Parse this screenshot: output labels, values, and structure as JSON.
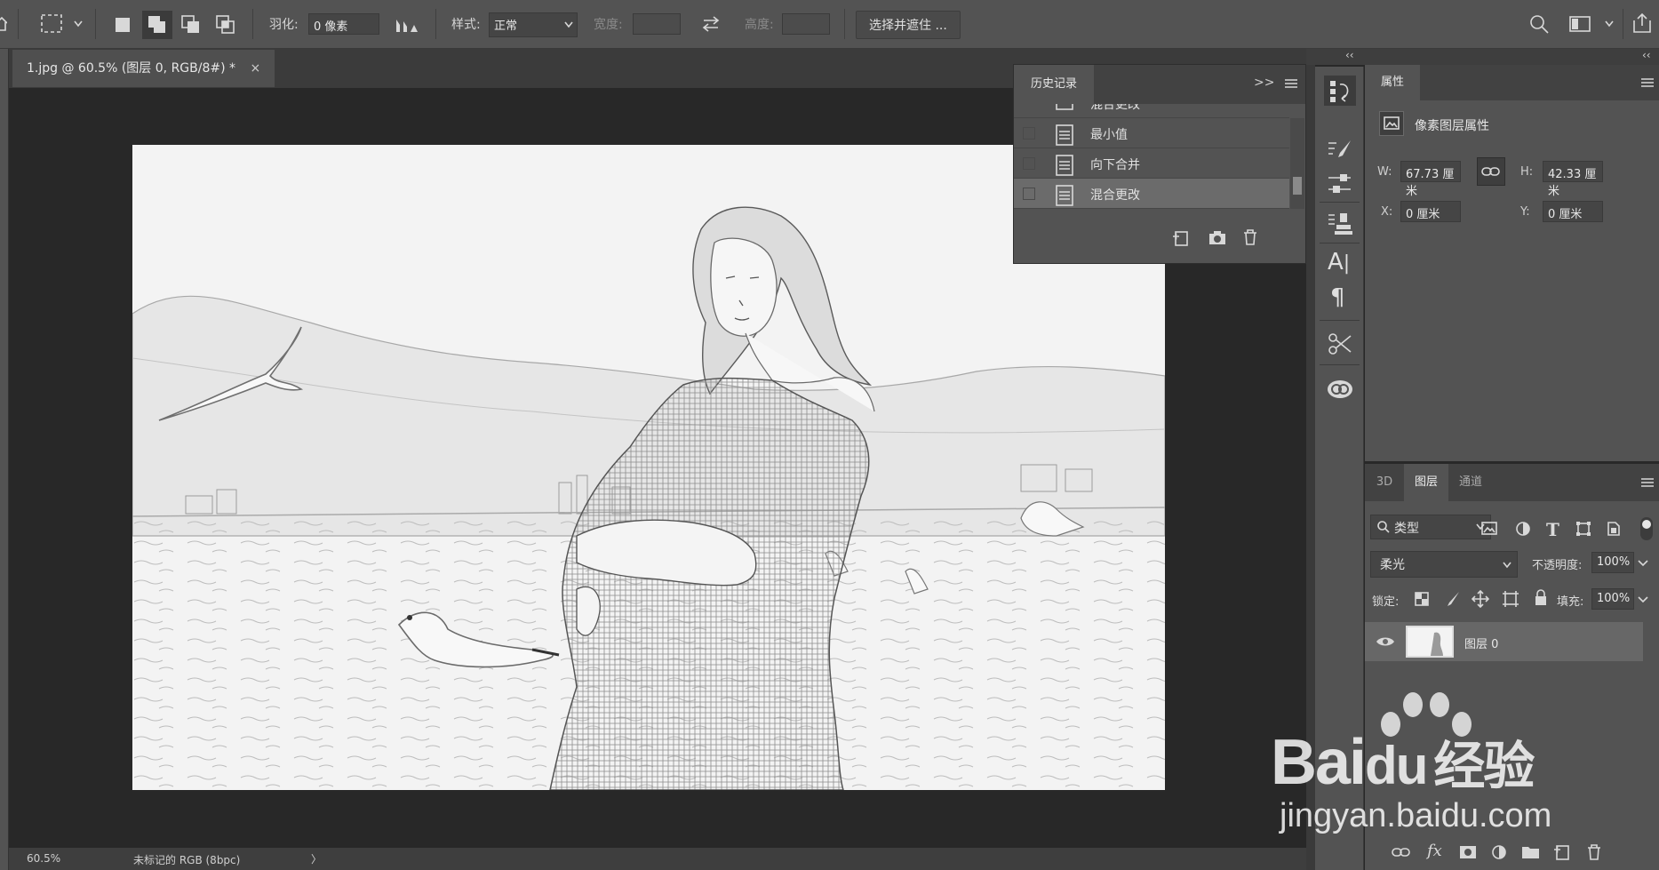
{
  "options_bar": {
    "feather_label": "羽化:",
    "feather_value": "0 像素",
    "style_label": "样式:",
    "style_value": "正常",
    "width_label": "宽度:",
    "height_label": "高度:",
    "select_mask_button": "选择并遮住 ..."
  },
  "document": {
    "tab_title": "1.jpg @ 60.5% (图层 0, RGB/8#) *",
    "close": "×"
  },
  "status_bar": {
    "zoom": "60.5%",
    "profile": "未标记的 RGB (8bpc)",
    "arrow": "〉"
  },
  "history_panel": {
    "title": "历史记录",
    "expand": ">>",
    "items": [
      {
        "label": "混合更改"
      },
      {
        "label": "最小值"
      },
      {
        "label": "向下合并"
      },
      {
        "label": "混合更改"
      }
    ]
  },
  "collapse_arrows": "‹‹",
  "properties_panel": {
    "title": "属性",
    "subtitle": "像素图层属性",
    "w_label": "W:",
    "w_value": "67.73 厘米",
    "h_label": "H:",
    "h_value": "42.33 厘米",
    "x_label": "X:",
    "x_value": "0 厘米",
    "y_label": "Y:",
    "y_value": "0 厘米"
  },
  "layers_panel": {
    "tabs": [
      "3D",
      "图层",
      "通道"
    ],
    "active_tab": "图层",
    "filter_kind": "类型",
    "blend_mode": "柔光",
    "opacity_label": "不透明度:",
    "opacity_value": "100%",
    "lock_label": "锁定:",
    "fill_label": "填充:",
    "fill_value": "100%",
    "layers": [
      {
        "name": "图层 0",
        "visible": true
      }
    ]
  },
  "watermark": {
    "brand_left": "Bai",
    "brand_mid": "du",
    "brand_cn": "经验",
    "url": "jingyan.baidu.com"
  },
  "colors": {
    "panel": "#535353",
    "panel_dark": "#424242",
    "canvas_bg": "#282828",
    "selected_row": "#6b6b6b"
  }
}
